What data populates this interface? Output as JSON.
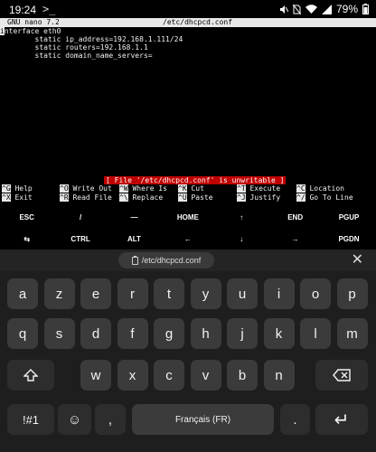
{
  "status_bar": {
    "time": "19:24",
    "terminal_glyph": ">_",
    "battery": "79%"
  },
  "nano": {
    "version": "GNU nano 7.2",
    "filename": "/etc/dhcpcd.conf",
    "lines": [
      "interface eth0",
      "        static ip_address=192.168.1.111/24",
      "        static routers=192.168.1.1",
      "        static domain_name_servers="
    ],
    "status_message": "[ File '/etc/dhcpcd.conf' is unwritable ]",
    "shortcuts_row1": [
      {
        "key": "^G",
        "label": "Help"
      },
      {
        "key": "^O",
        "label": "Write Out"
      },
      {
        "key": "^W",
        "label": "Where Is"
      },
      {
        "key": "^K",
        "label": "Cut"
      },
      {
        "key": "^T",
        "label": "Execute"
      },
      {
        "key": "^C",
        "label": "Location"
      }
    ],
    "shortcuts_row2": [
      {
        "key": "^X",
        "label": "Exit"
      },
      {
        "key": "^R",
        "label": "Read File"
      },
      {
        "key": "^\\",
        "label": "Replace"
      },
      {
        "key": "^U",
        "label": "Paste"
      },
      {
        "key": "^J",
        "label": "Justify"
      },
      {
        "key": "^/",
        "label": "Go To Line"
      }
    ]
  },
  "extra_keys": {
    "row1": [
      "ESC",
      "/",
      "―",
      "HOME",
      "↑",
      "END",
      "PGUP"
    ],
    "row2": [
      "⇆",
      "CTRL",
      "ALT",
      "←",
      "↓",
      "→",
      "PGDN"
    ]
  },
  "suggestion": {
    "chip_text": "/etc/dhcpcd.conf",
    "close_glyph": "✕"
  },
  "keyboard": {
    "row1": [
      "a",
      "z",
      "e",
      "r",
      "t",
      "y",
      "u",
      "i",
      "o",
      "p"
    ],
    "row2": [
      "q",
      "s",
      "d",
      "f",
      "g",
      "h",
      "j",
      "k",
      "l",
      "m"
    ],
    "row3": [
      "w",
      "x",
      "c",
      "v",
      "b",
      "n"
    ],
    "symbols_label": "!#1",
    "emoji_glyph": "☺",
    "comma": ",",
    "space_label": "Français (FR)",
    "period": ".",
    "enter_glyph": "↵"
  }
}
